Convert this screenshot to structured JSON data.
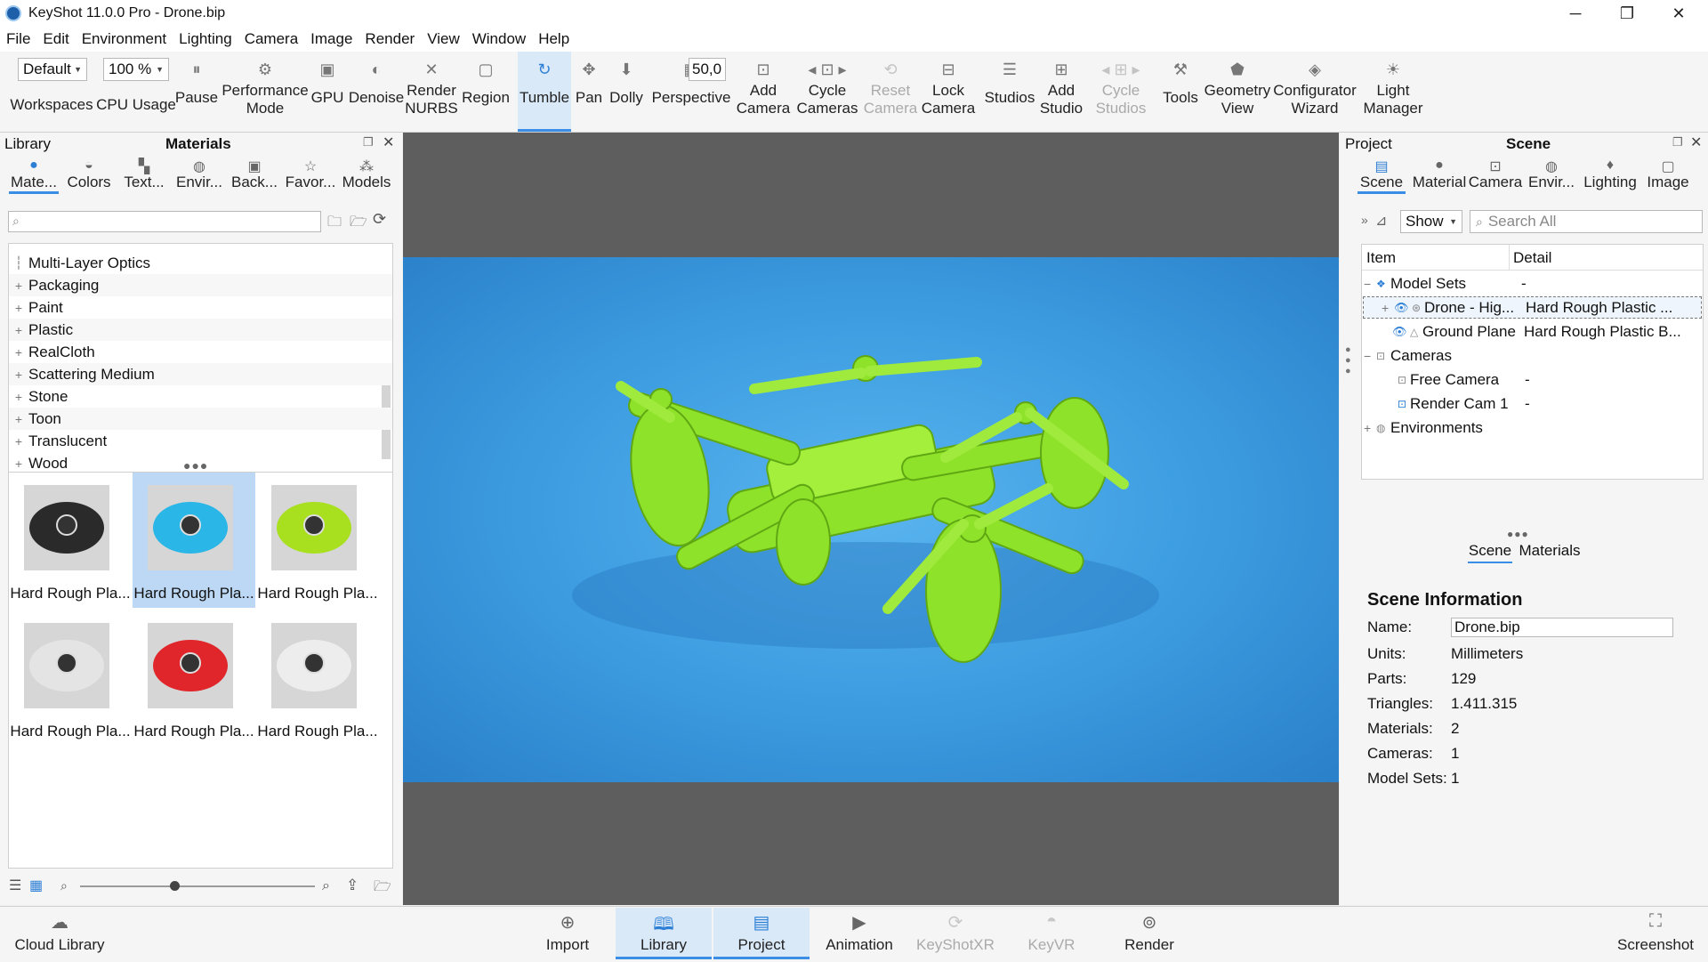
{
  "window": {
    "title": "KeyShot 11.0.0 Pro  - Drone.bip",
    "minimize": "─",
    "restore": "❐",
    "close": "✕"
  },
  "menu": [
    "File",
    "Edit",
    "Environment",
    "Lighting",
    "Camera",
    "Image",
    "Render",
    "View",
    "Window",
    "Help"
  ],
  "toolbar": {
    "workspace_value": "Default",
    "workspace_label": "Workspaces",
    "cpu_value": "100 %",
    "cpu_label": "CPU Usage",
    "pause": "Pause",
    "performance_mode": "Performance\nMode",
    "gpu": "GPU",
    "denoise": "Denoise",
    "render_nurbs": "Render\nNURBS",
    "region": "Region",
    "tumble": "Tumble",
    "pan": "Pan",
    "dolly": "Dolly",
    "perspective": "Perspective",
    "focal_value": "50,0",
    "add_camera": "Add\nCamera",
    "cycle_cameras": "Cycle\nCameras",
    "reset_camera": "Reset\nCamera",
    "lock_camera": "Lock\nCamera",
    "studios": "Studios",
    "add_studio": "Add\nStudio",
    "cycle_studios": "Cycle\nStudios",
    "tools": "Tools",
    "geometry_view": "Geometry\nView",
    "configurator_wizard": "Configurator\nWizard",
    "light_manager": "Light\nManager"
  },
  "library": {
    "header_left": "Library",
    "header_title": "Materials",
    "tabs": [
      "Mate...",
      "Colors",
      "Text...",
      "Envir...",
      "Back...",
      "Favor...",
      "Models"
    ],
    "search_placeholder": "",
    "tree": [
      "Multi-Layer Optics",
      "Packaging",
      "Paint",
      "Plastic",
      "RealCloth",
      "Scattering Medium",
      "Stone",
      "Toon",
      "Translucent",
      "Wood"
    ],
    "thumbs": [
      {
        "label": "Hard Rough Pla...",
        "color": "#2a2a2a"
      },
      {
        "label": "Hard Rough Pla...",
        "color": "#2bb6e8"
      },
      {
        "label": "Hard Rough Pla...",
        "color": "#a8e020"
      },
      {
        "label": "Hard Rough Pla...",
        "color": "#e4e4e4"
      },
      {
        "label": "Hard Rough Pla...",
        "color": "#e0262a"
      },
      {
        "label": "Hard Rough Pla...",
        "color": "#ededed"
      }
    ],
    "thumb_size_pct": 40
  },
  "project": {
    "header_left": "Project",
    "header_title": "Scene",
    "tabs": [
      "Scene",
      "Material",
      "Camera",
      "Envir...",
      "Lighting",
      "Image"
    ],
    "show_label": "Show",
    "search_placeholder": "Search All",
    "col_item": "Item",
    "col_detail": "Detail",
    "tree": [
      {
        "item": "Model Sets",
        "detail": "-"
      },
      {
        "item": "Drone - Hig...",
        "detail": "Hard Rough Plastic ..."
      },
      {
        "item": "Ground Plane",
        "detail": "Hard Rough Plastic B..."
      },
      {
        "item": "Cameras",
        "detail": ""
      },
      {
        "item": "Free Camera",
        "detail": "-"
      },
      {
        "item": "Render Cam 1",
        "detail": "-"
      },
      {
        "item": "Environments",
        "detail": ""
      }
    ],
    "sub_tabs": [
      "Scene",
      "Materials"
    ],
    "info_title": "Scene Information",
    "info": [
      {
        "k": "Name:",
        "v": "Drone.bip"
      },
      {
        "k": "Units:",
        "v": "Millimeters"
      },
      {
        "k": "Parts:",
        "v": "129"
      },
      {
        "k": "Triangles:",
        "v": "1.411.315"
      },
      {
        "k": "Materials:",
        "v": "2"
      },
      {
        "k": "Cameras:",
        "v": "1"
      },
      {
        "k": "Model Sets:",
        "v": "1"
      }
    ]
  },
  "bottom": {
    "cloud_library": "Cloud Library",
    "import": "Import",
    "library": "Library",
    "project": "Project",
    "animation": "Animation",
    "keyshotxr": "KeyShotXR",
    "keyvr": "KeyVR",
    "render": "Render",
    "screenshot": "Screenshot"
  },
  "colors": {
    "accent": "#3a8ee6",
    "viewport_bg": "#5e5e5e",
    "scene_blue": "#3d9be0",
    "drone_green": "#8fe22a"
  }
}
